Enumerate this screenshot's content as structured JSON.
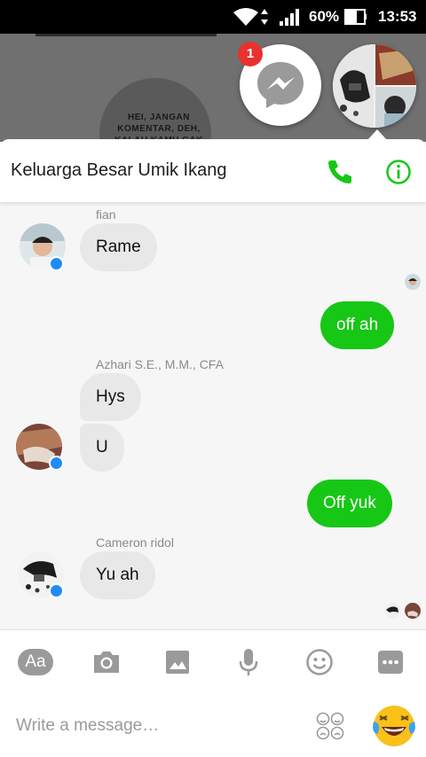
{
  "status_bar": {
    "battery": "60%",
    "time": "13:53"
  },
  "background": {
    "comic_text": "HEI, JANGAN KOMENTAR, DEH, KALAU KAMU GAK"
  },
  "chat_head": {
    "badge_count": "1"
  },
  "header": {
    "title": "Keluarga Besar Umik Ikang"
  },
  "messages": {
    "m1": {
      "sender": "fian",
      "text": "Rame"
    },
    "m2": {
      "text": "off ah"
    },
    "m3": {
      "sender": "Azhari S.E., M.M., CFA",
      "text_a": "Hys",
      "text_b": "U"
    },
    "m4": {
      "text": "Off yuk"
    },
    "m5": {
      "sender": "Cameron ridol",
      "text": "Yu ah"
    }
  },
  "toolbar": {
    "aa_label": "Aa"
  },
  "composer": {
    "placeholder": "Write a message…"
  },
  "colors": {
    "accent_green": "#16c716",
    "messenger_blue": "#1f8cf5",
    "badge_red": "#e9312f"
  }
}
